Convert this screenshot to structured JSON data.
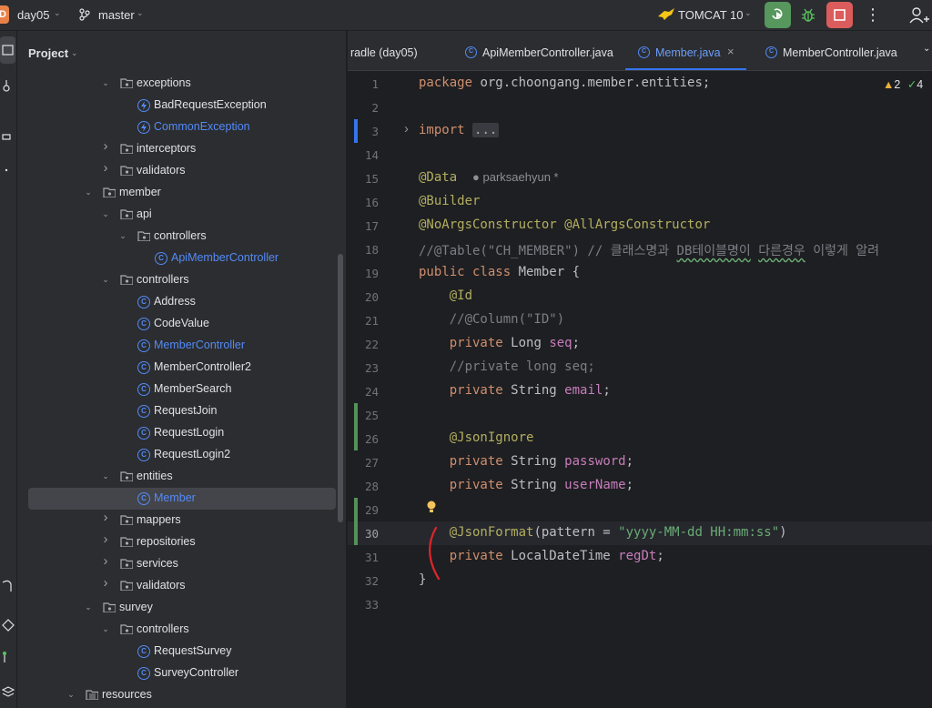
{
  "titlebar": {
    "project_badge": "D",
    "project_name": "day05",
    "branch": "master",
    "run_config": "TOMCAT 10"
  },
  "project_panel": {
    "title": "Project",
    "tree": [
      {
        "label": "exceptions",
        "kind": "folder",
        "depth": 3,
        "expanded": true
      },
      {
        "label": "BadRequestException",
        "kind": "exception",
        "depth": 4
      },
      {
        "label": "CommonException",
        "kind": "exception",
        "depth": 4,
        "highlight": true
      },
      {
        "label": "interceptors",
        "kind": "folder",
        "depth": 3,
        "expanded": false
      },
      {
        "label": "validators",
        "kind": "folder",
        "depth": 3,
        "expanded": false
      },
      {
        "label": "member",
        "kind": "folder",
        "depth": 2,
        "expanded": true
      },
      {
        "label": "api",
        "kind": "folder",
        "depth": 3,
        "expanded": true
      },
      {
        "label": "controllers",
        "kind": "folder",
        "depth": 4,
        "expanded": true
      },
      {
        "label": "ApiMemberController",
        "kind": "class",
        "depth": 5,
        "highlight": true
      },
      {
        "label": "controllers",
        "kind": "folder",
        "depth": 3,
        "expanded": true
      },
      {
        "label": "Address",
        "kind": "class",
        "depth": 4
      },
      {
        "label": "CodeValue",
        "kind": "class",
        "depth": 4
      },
      {
        "label": "MemberController",
        "kind": "class",
        "depth": 4,
        "highlight": true
      },
      {
        "label": "MemberController2",
        "kind": "class",
        "depth": 4
      },
      {
        "label": "MemberSearch",
        "kind": "class",
        "depth": 4
      },
      {
        "label": "RequestJoin",
        "kind": "class",
        "depth": 4
      },
      {
        "label": "RequestLogin",
        "kind": "class",
        "depth": 4
      },
      {
        "label": "RequestLogin2",
        "kind": "class-r",
        "depth": 4
      },
      {
        "label": "entities",
        "kind": "folder",
        "depth": 3,
        "expanded": true
      },
      {
        "label": "Member",
        "kind": "class",
        "depth": 4,
        "highlight": true,
        "selected": true
      },
      {
        "label": "mappers",
        "kind": "folder",
        "depth": 3,
        "expanded": false
      },
      {
        "label": "repositories",
        "kind": "folder",
        "depth": 3,
        "expanded": false
      },
      {
        "label": "services",
        "kind": "folder",
        "depth": 3,
        "expanded": false
      },
      {
        "label": "validators",
        "kind": "folder",
        "depth": 3,
        "expanded": false
      },
      {
        "label": "survey",
        "kind": "folder",
        "depth": 2,
        "expanded": true
      },
      {
        "label": "controllers",
        "kind": "folder",
        "depth": 3,
        "expanded": true
      },
      {
        "label": "RequestSurvey",
        "kind": "class",
        "depth": 4
      },
      {
        "label": "SurveyController",
        "kind": "class",
        "depth": 4
      },
      {
        "label": "resources",
        "kind": "resources",
        "depth": 1,
        "expanded": true
      }
    ]
  },
  "tabs": [
    {
      "label": "radle (day05)",
      "icon": false,
      "active": false
    },
    {
      "label": "ApiMemberController.java",
      "icon": true,
      "active": false
    },
    {
      "label": "Member.java",
      "icon": true,
      "active": true,
      "closable": true
    },
    {
      "label": "MemberController.java",
      "icon": true,
      "active": false
    }
  ],
  "tab_close_glyph": "×",
  "editor": {
    "warnings": "2",
    "checks": "4",
    "author_hint": "parksaehyun *",
    "current_line": "30",
    "lines": [
      {
        "n": "1",
        "html": "<span class=\"kw\">package</span> org.choongang.member.entities;"
      },
      {
        "n": "2",
        "html": ""
      },
      {
        "n": "3",
        "html": "<span class=\"kw\">import</span> <span class=\"fold-box\">...</span>",
        "fold": true,
        "mark": "blue"
      },
      {
        "n": "14",
        "html": ""
      },
      {
        "n": "15",
        "html": "<span class=\"ann\">@Data</span>  <span class=\"author-hint\">&#9679; <span data-bind=\"editor.author_hint\"></span></span>"
      },
      {
        "n": "16",
        "html": "<span class=\"ann\">@Builder</span>"
      },
      {
        "n": "17",
        "html": "<span class=\"ann\">@NoArgsConstructor</span> <span class=\"ann\">@AllArgsConstructor</span>"
      },
      {
        "n": "18",
        "html": "<span class=\"cmt\">//@Table(\"CH_MEMBER\") // 클래스명과 <span class=\"wavy\">DB테이블명이</span> <span class=\"wavy\">다른경우</span> 이렇게 알려</span>"
      },
      {
        "n": "19",
        "html": "<span class=\"kw\">public class</span> Member {"
      },
      {
        "n": "20",
        "html": "    <span class=\"ann\">@Id</span>"
      },
      {
        "n": "21",
        "html": "    <span class=\"cmt\">//@Column(\"ID\")</span>"
      },
      {
        "n": "22",
        "html": "    <span class=\"kw\">private</span> Long <span class=\"fld\">seq</span>;"
      },
      {
        "n": "23",
        "html": "    <span class=\"cmt\">//private long seq;</span>"
      },
      {
        "n": "24",
        "html": "    <span class=\"kw\">private</span> String <span class=\"fld\">email</span>;"
      },
      {
        "n": "25",
        "html": "",
        "mark": "green"
      },
      {
        "n": "26",
        "html": "    <span class=\"ann\">@JsonIgnore</span>",
        "mark": "green"
      },
      {
        "n": "27",
        "html": "    <span class=\"kw\">private</span> String <span class=\"fld\">password</span>;"
      },
      {
        "n": "28",
        "html": "    <span class=\"kw\">private</span> String <span class=\"fld\">userName</span>;"
      },
      {
        "n": "29",
        "html": "",
        "mark": "green"
      },
      {
        "n": "30",
        "html": "    <span class=\"ann\">@JsonFormat</span>(pattern = <span class=\"str\">\"yyyy-MM-dd HH:mm:ss\"</span>)",
        "mark": "green"
      },
      {
        "n": "31",
        "html": "    <span class=\"kw\">private</span> LocalDateTime <span class=\"fld\">regDt</span>;"
      },
      {
        "n": "32",
        "html": "}"
      },
      {
        "n": "33",
        "html": ""
      }
    ]
  },
  "colors": {
    "accent": "#3574f0",
    "run_green": "#57965c",
    "stop_red": "#db5c5c",
    "change_green": "#549159",
    "change_blue": "#3574f0",
    "annotation_mark": "#e0252b"
  }
}
